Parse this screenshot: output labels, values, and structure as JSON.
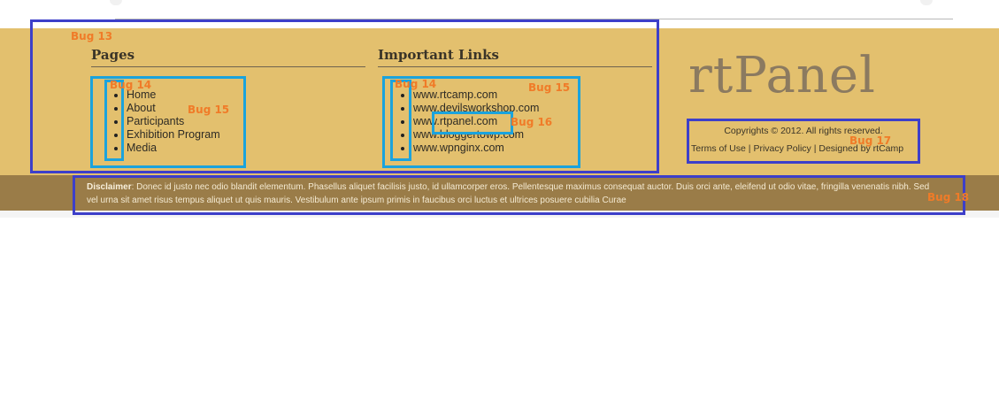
{
  "footer": {
    "pages": {
      "heading": "Pages",
      "items": [
        "Home",
        "About",
        "Participants",
        "Exhibition Program",
        "Media"
      ]
    },
    "links": {
      "heading": "Important Links",
      "items": [
        "www.rtcamp.com",
        "www.devilsworkshop.com",
        "www.rtpanel.com",
        "www.bloggertowp.com",
        "www.wpnginx.com"
      ]
    },
    "logo_text": "rtPanel",
    "copyright": "Copyrights © 2012. All rights reserved.",
    "bottom_links": {
      "terms": "Terms of Use",
      "privacy": "Privacy Policy",
      "designed_by": "Designed by rtCamp",
      "separator": "|"
    }
  },
  "disclaimer": {
    "label": "Disclaimer",
    "text": ": Donec id justo nec odio blandit elementum. Phasellus aliquet facilisis justo, id ullamcorper eros. Pellentesque maximus consequat auctor. Duis orci ante, eleifend ut odio vitae, fringilla venenatis nibh. Sed vel urna sit amet risus tempus aliquet ut quis mauris. Vestibulum ante ipsum primis in faucibus orci luctus et ultrices posuere cubilia Curae"
  },
  "bug_tags": [
    "Bug 13",
    "Bug 14",
    "Bug 15",
    "Bug 14",
    "Bug 15",
    "Bug 16",
    "Bug 17",
    "Bug 18"
  ],
  "colors": {
    "footer_bg": "#e3c06e",
    "disclaimer_bg": "#9a7c48",
    "annotation_dark": "#3d3fc9",
    "annotation_light": "#1ba3dd",
    "bug_tag": "#f07b28"
  }
}
